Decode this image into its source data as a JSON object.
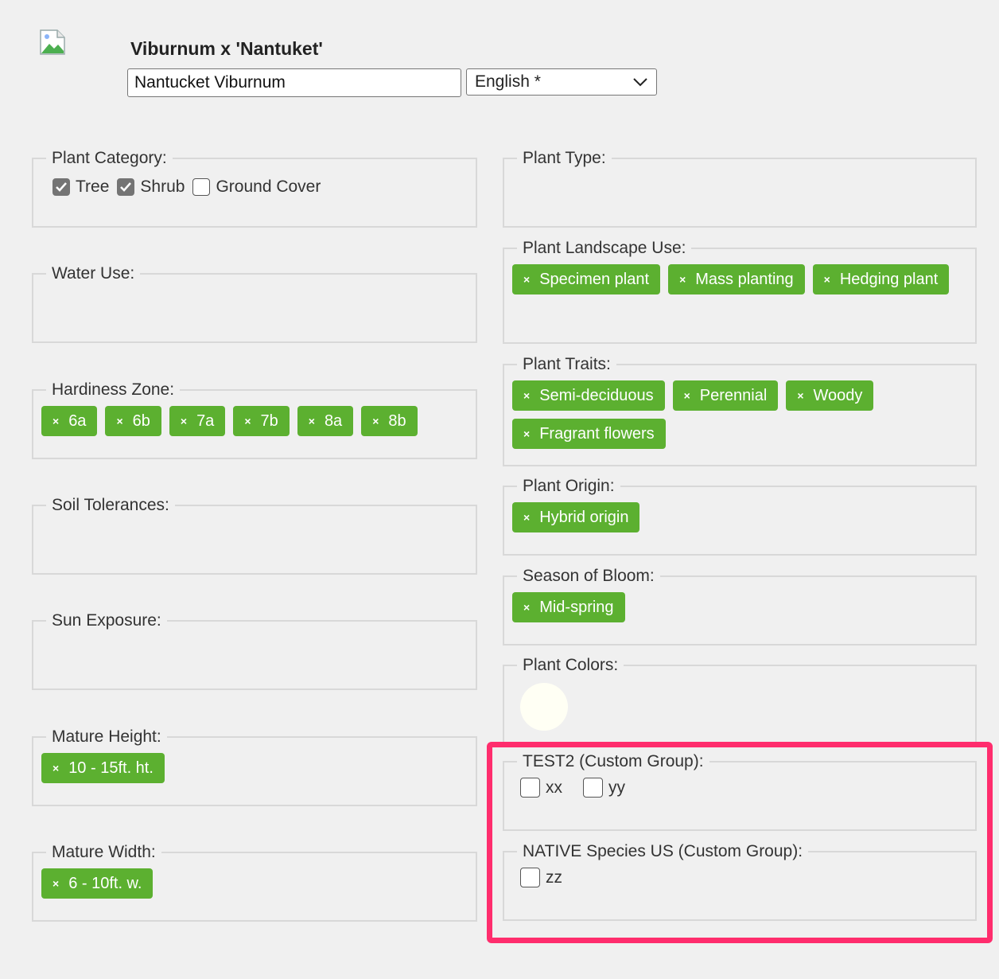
{
  "header": {
    "plant_name": "Viburnum x 'Nantuket'",
    "common_name_value": "Nantucket Viburnum",
    "language_selected": "English *"
  },
  "left_groups": {
    "category": {
      "legend": "Plant Category:",
      "options": [
        {
          "label": "Tree",
          "checked": true
        },
        {
          "label": "Shrub",
          "checked": true
        },
        {
          "label": "Ground Cover",
          "checked": false
        }
      ]
    },
    "water_use": {
      "legend": "Water Use:"
    },
    "hardiness": {
      "legend": "Hardiness Zone:",
      "tags": [
        "6a",
        "6b",
        "7a",
        "7b",
        "8a",
        "8b"
      ]
    },
    "soil": {
      "legend": "Soil Tolerances:"
    },
    "sun": {
      "legend": "Sun Exposure:"
    },
    "height": {
      "legend": "Mature Height:",
      "tags": [
        "10 - 15ft. ht."
      ]
    },
    "width": {
      "legend": "Mature Width:",
      "tags": [
        "6 - 10ft. w."
      ]
    }
  },
  "right_groups": {
    "type": {
      "legend": "Plant Type:"
    },
    "landscape": {
      "legend": "Plant Landscape Use:",
      "tags": [
        "Specimen plant",
        "Mass planting",
        "Hedging plant"
      ]
    },
    "traits": {
      "legend": "Plant Traits:",
      "tags": [
        "Semi-deciduous",
        "Perennial",
        "Woody",
        "Fragrant flowers"
      ]
    },
    "origin": {
      "legend": "Plant Origin:",
      "tags": [
        "Hybrid origin"
      ]
    },
    "bloom": {
      "legend": "Season of Bloom:",
      "tags": [
        "Mid-spring"
      ]
    },
    "colors": {
      "legend": "Plant Colors:",
      "swatch_color": "#fffff4"
    },
    "test2": {
      "legend": "TEST2 (Custom Group):",
      "options": [
        "xx",
        "yy"
      ]
    },
    "native": {
      "legend": "NATIVE Species US (Custom Group):",
      "options": [
        "zz"
      ]
    }
  },
  "colors": {
    "tag_green": "#5cb030",
    "highlight": "#ff2d6d"
  },
  "icons": {
    "remove_tag": "×"
  }
}
